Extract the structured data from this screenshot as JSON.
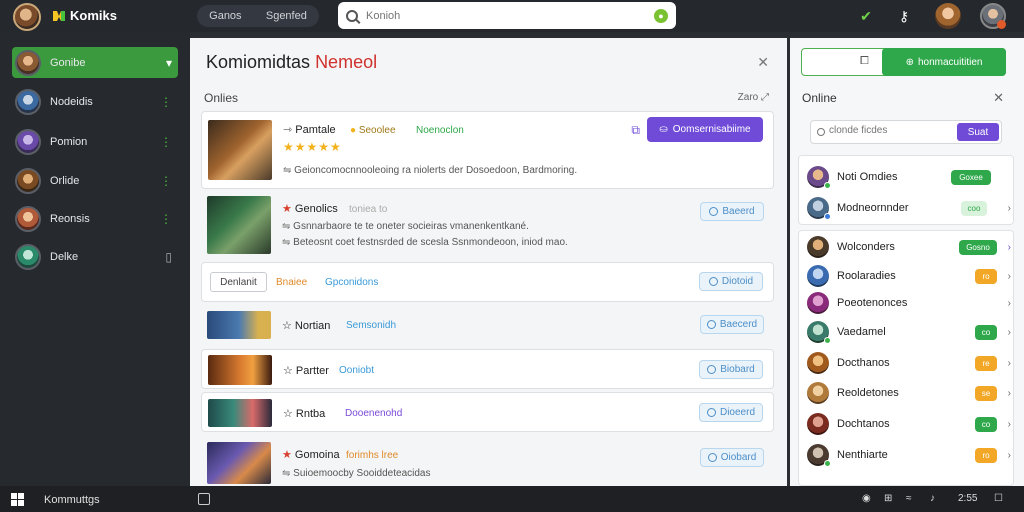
{
  "app": {
    "name": "Komiks"
  },
  "topbar": {
    "tabs": [
      "Ganos",
      "Sgenfed"
    ],
    "search_placeholder": "Konioh"
  },
  "sidebar": {
    "items": [
      {
        "label": "Gonibe",
        "active": true,
        "indicator": "▾"
      },
      {
        "label": "Nodeidis",
        "indicator": "⋮"
      },
      {
        "label": "Pomion",
        "indicator": "⋮"
      },
      {
        "label": "Orlide",
        "indicator": "⋮"
      },
      {
        "label": "Reonsis",
        "indicator": "⋮"
      },
      {
        "label": "Delke",
        "indicator": "▯"
      }
    ]
  },
  "main": {
    "title": "Komiomidtas",
    "title_red": "Nemeol",
    "section_label": "Onlies",
    "sort_label": "Zaro",
    "rows": [
      {
        "title": "Pamtale",
        "tag1": "Seoolee",
        "tag2": "Noenoclon",
        "desc": "Geioncomocnnooleoing ra niolerts der Dosoedoon, Bardmoring.",
        "button": "Oomsernisabiime"
      },
      {
        "title": "Genolics",
        "sub": "toniea to",
        "desc1": "Gsnnarbaore te te oneter socieiras vmanenkentkané.",
        "desc2": "Beteosnt coet festnsrded de scesla Ssnmondeoon, iniod mao.",
        "pill": "Baeerd"
      },
      {
        "chip": "Denlanit",
        "tag1": "Bnaiee",
        "tag2": "Gpconidons",
        "pill": "Diotoid"
      },
      {
        "title": "Nortian",
        "tag": "Semsonidh",
        "pill": "Baecerd"
      },
      {
        "title": "Partter",
        "tag": "Ooniobt",
        "pill": "Biobard"
      },
      {
        "title": "Rntba",
        "tag": "Dooenenohd",
        "pill": "Dioeerd"
      },
      {
        "title": "Gomoina",
        "sub": "forimhs lree",
        "desc": "Suioemoocby Sooiddeteacidas",
        "pill": "Oiobard"
      }
    ]
  },
  "right_panel": {
    "top_button": "honmacuititien",
    "section_label": "Online",
    "search_placeholder": "clonde ficdes",
    "search_button": "Suat",
    "users": [
      {
        "name": "Noti Omdies",
        "badge": "Goxee",
        "badge_color": "#2ea84a"
      },
      {
        "name": "Modneornnder",
        "badge": "coo",
        "badge_color": "#bfe9c6"
      },
      {
        "name": "Wolconders",
        "badge": "Gosno",
        "badge_color": "#2ea84a"
      },
      {
        "name": "Roolaradies",
        "badge": "ro",
        "badge_color": "#f2a726"
      },
      {
        "name": "Poeotenonces",
        "badge": "",
        "badge_color": ""
      },
      {
        "name": "Vaedamel",
        "badge": "co",
        "badge_color": "#2ea84a"
      },
      {
        "name": "Docthanos",
        "badge": "re",
        "badge_color": "#f2a726"
      },
      {
        "name": "Reoldetones",
        "badge": "se",
        "badge_color": "#f2a726"
      },
      {
        "name": "Dochtanos",
        "badge": "co",
        "badge_color": "#2ea84a"
      },
      {
        "name": "Nenthiarte",
        "badge": "ro",
        "badge_color": "#f2a726"
      }
    ]
  },
  "taskbar": {
    "label": "Kommuttgs",
    "time": "2:55"
  }
}
